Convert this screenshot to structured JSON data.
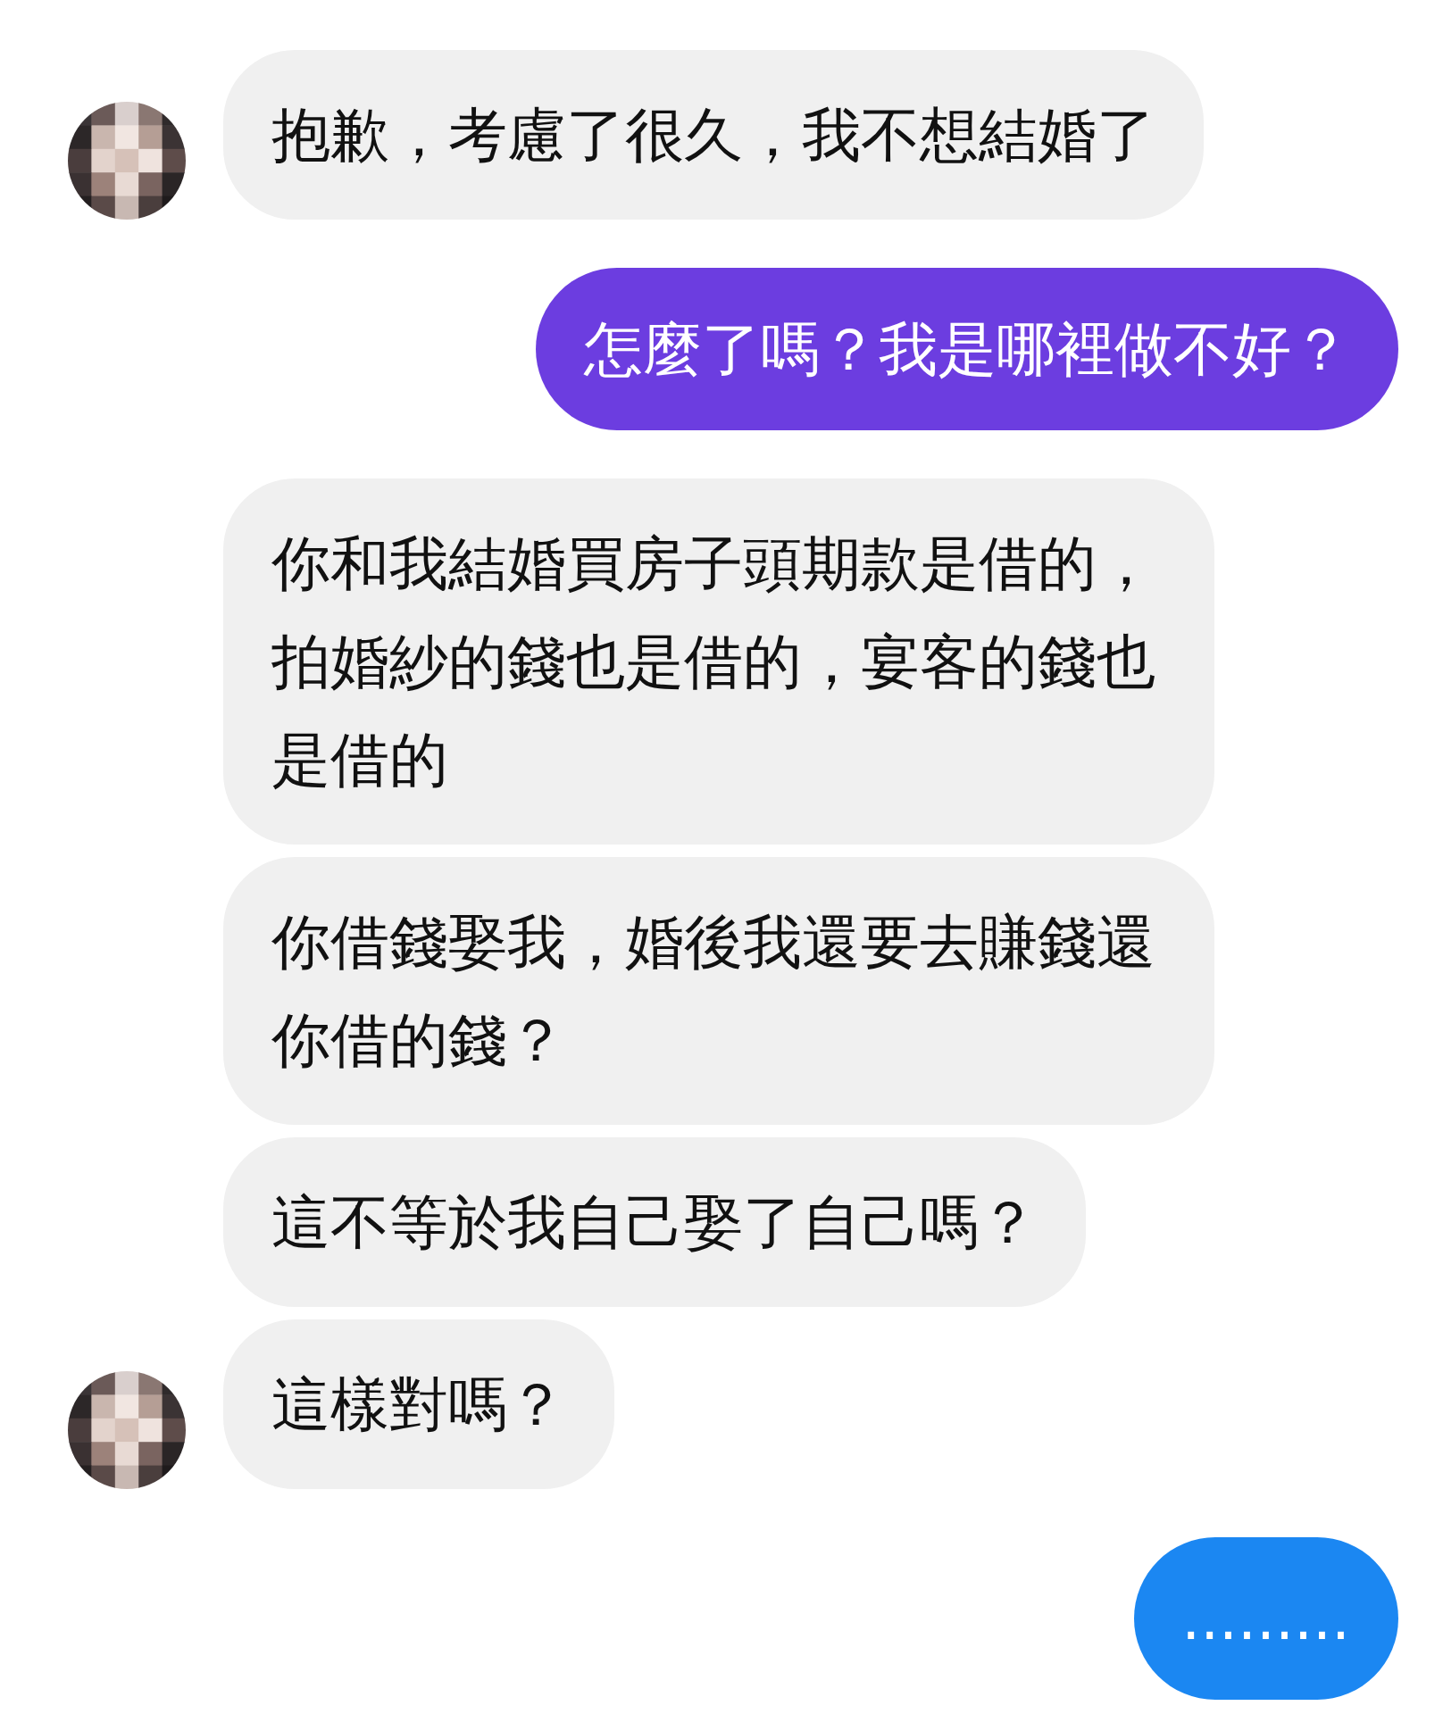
{
  "messages": [
    {
      "kind": "incoming",
      "avatar": true,
      "color": "#f0f0f0",
      "text": "抱歉，考慮了很久，我不想結婚了"
    },
    {
      "kind": "outgoing",
      "color": "#6c3de0",
      "text": "怎麼了嗎？我是哪裡做不好？"
    },
    {
      "kind": "incoming",
      "avatar": false,
      "color": "#f0f0f0",
      "text": "你和我結婚買房子頭期款是借的，拍婚紗的錢也是借的，宴客的錢也是借的"
    },
    {
      "kind": "incoming",
      "avatar": false,
      "color": "#f0f0f0",
      "text": "你借錢娶我，婚後我還要去賺錢還你借的錢？"
    },
    {
      "kind": "incoming",
      "avatar": false,
      "color": "#f0f0f0",
      "text": "這不等於我自己娶了自己嗎？"
    },
    {
      "kind": "incoming",
      "avatar": true,
      "color": "#f0f0f0",
      "text": "這樣對嗎？"
    },
    {
      "kind": "outgoing",
      "color": "#1b87f2",
      "text": "........."
    }
  ]
}
